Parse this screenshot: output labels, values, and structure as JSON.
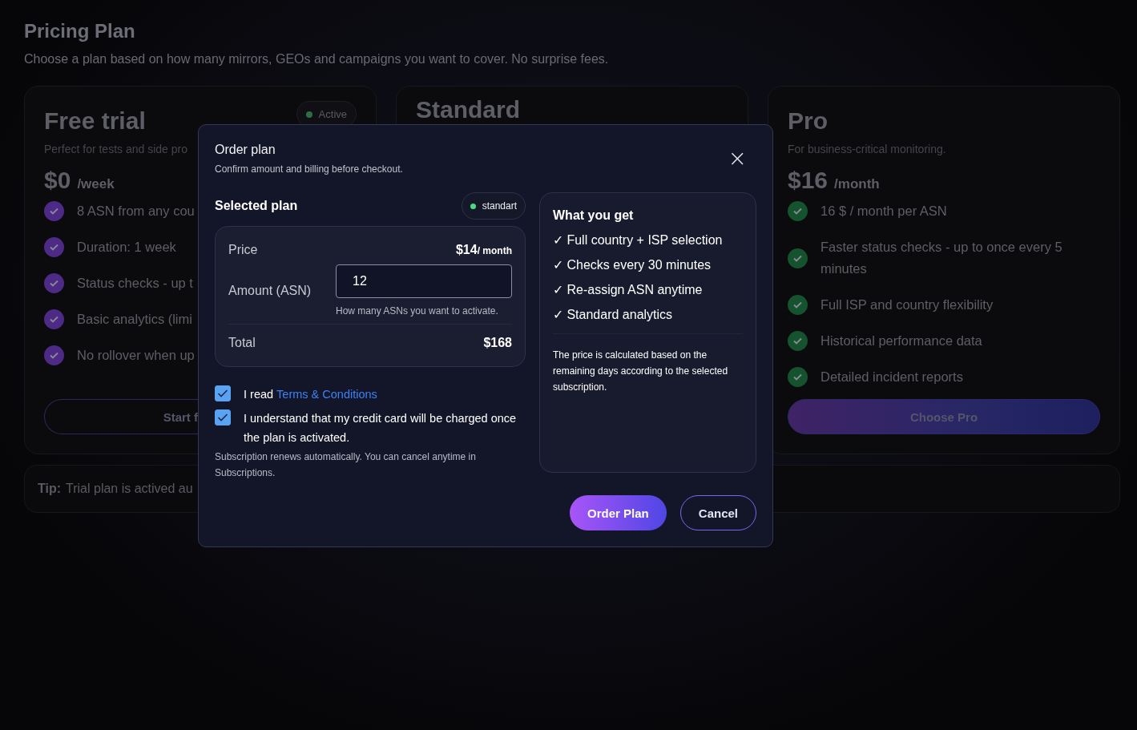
{
  "page": {
    "title": "Pricing Plan",
    "subtitle": "Choose a plan based on how many mirrors, GEOs and campaigns you want to cover. No surprise fees."
  },
  "plans": [
    {
      "name": "Free trial",
      "description": "Perfect for tests and side pro",
      "price": "$0",
      "period": "/week",
      "color": "#4c2a85",
      "badge": {
        "label": "Active"
      },
      "features": [
        "8 ASN from any cou",
        "Duration: 1 week",
        "Status checks - up t",
        "Basic analytics (limi",
        "No rollover when up"
      ],
      "button": {
        "label": "Start f",
        "kind": "outline"
      }
    },
    {
      "name": "Standard"
    },
    {
      "name": "Pro",
      "description": "For business-critical monitoring.",
      "price": "$16",
      "period": "/month",
      "color": "#14532d",
      "features": [
        "16 $ / month per ASN",
        "Faster status checks - up to once every 5 minutes",
        "Full ISP and country flexibility",
        "Historical performance data",
        "Detailed incident reports"
      ],
      "button": {
        "label": "Choose Pro",
        "kind": "gradient"
      }
    }
  ],
  "tip": {
    "label": "Tip:",
    "text": "Trial plan is actived au"
  },
  "modal": {
    "title": "Order plan",
    "subtitle": "Confirm amount and billing before checkout.",
    "close": "×",
    "selected_label": "Selected plan",
    "plan_badge": "standart",
    "price_label": "Price",
    "price": "$14",
    "price_unit": "/ month",
    "amount_label": "Amount (ASN)",
    "amount_value": "12",
    "amount_hint": "How many ASNs you want to activate.",
    "total_label": "Total",
    "total": "$168",
    "agreements": [
      {
        "checked": true,
        "text": "I read",
        "link": "Terms & Conditions"
      },
      {
        "checked": true,
        "text": "I understand that my credit card will be charged once the plan is activated."
      }
    ],
    "note": "Subscription renews automatically. You can cancel anytime in Subscriptions.",
    "benefits_title": "What you get",
    "benefits": [
      "✓ Full country + ISP selection",
      "✓ Checks every 30 minutes",
      "✓ Re-assign ASN anytime",
      "✓ Standard analytics"
    ],
    "benefits_note": "The price is calculated based on the remaining days according to the selected subscription.",
    "buttons": [
      {
        "label": "Order Plan",
        "kind": "primary"
      },
      {
        "label": "Cancel",
        "kind": "outline"
      }
    ]
  }
}
